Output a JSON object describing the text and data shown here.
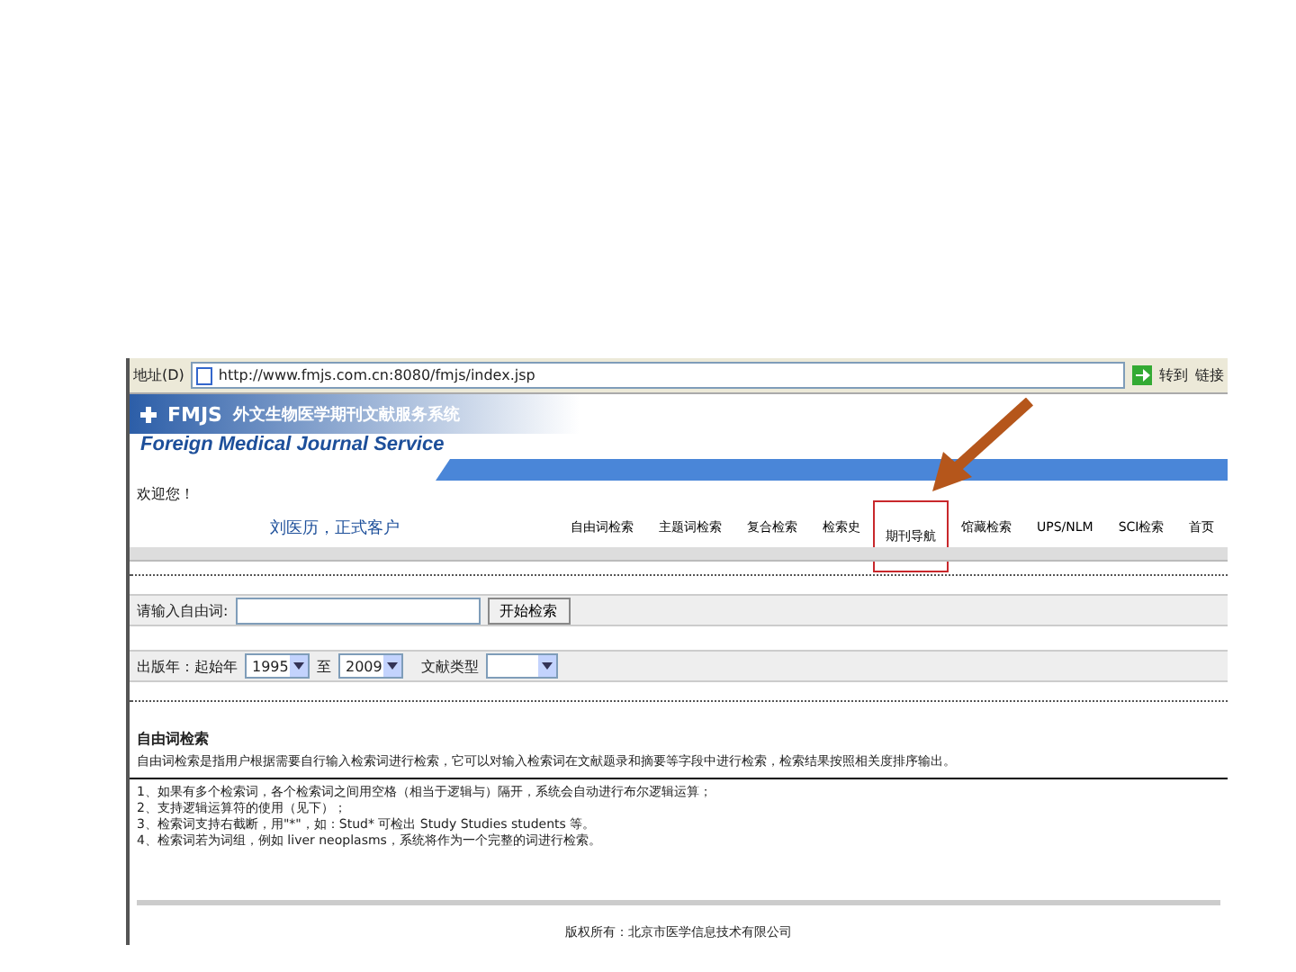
{
  "browser": {
    "address_label": "地址(D)",
    "url": "http://www.fmjs.com.cn:8080/fmjs/index.jsp",
    "go_label": "转到",
    "links_label": "链接"
  },
  "header": {
    "logo_mark": "FMJS",
    "title_cn": "外文生物医学期刊文献服务系统",
    "title_en": "Foreign Medical Journal Service"
  },
  "welcome": "欢迎您！",
  "user": "刘医历，正式客户",
  "nav": [
    {
      "label": "自由词检索",
      "highlighted": false
    },
    {
      "label": "主题词检索",
      "highlighted": false
    },
    {
      "label": "复合检索",
      "highlighted": false
    },
    {
      "label": "检索史",
      "highlighted": false
    },
    {
      "label": "期刊导航",
      "highlighted": true
    },
    {
      "label": "馆藏检索",
      "highlighted": false
    },
    {
      "label": "UPS/NLM",
      "highlighted": false
    },
    {
      "label": "SCI检索",
      "highlighted": false
    },
    {
      "label": "首页",
      "highlighted": false
    }
  ],
  "search": {
    "label": "请输入自由词:",
    "button": "开始检索"
  },
  "filters": {
    "year_label": "出版年：起始年",
    "from": "1995",
    "to_label": "至",
    "to": "2009",
    "type_label": "文献类型"
  },
  "help": {
    "title": "自由词检索",
    "intro": "自由词检索是指用户根据需要自行输入检索词进行检索，它可以对输入检索词在文献题录和摘要等字段中进行检索，检索结果按照相关度排序输出。",
    "tips": [
      "1、如果有多个检索词，各个检索词之间用空格（相当于逻辑与）隔开，系统会自动进行布尔逻辑运算；",
      "2、支持逻辑运算符的使用（见下）；",
      "3、检索词支持右截断，用\"*\"，如：Stud* 可检出 Study Studies students 等。",
      "4、检索词若为词组，例如 liver neoplasms，系统将作为一个完整的词进行检索。"
    ]
  },
  "footer": "版权所有：北京市医学信息技术有限公司"
}
